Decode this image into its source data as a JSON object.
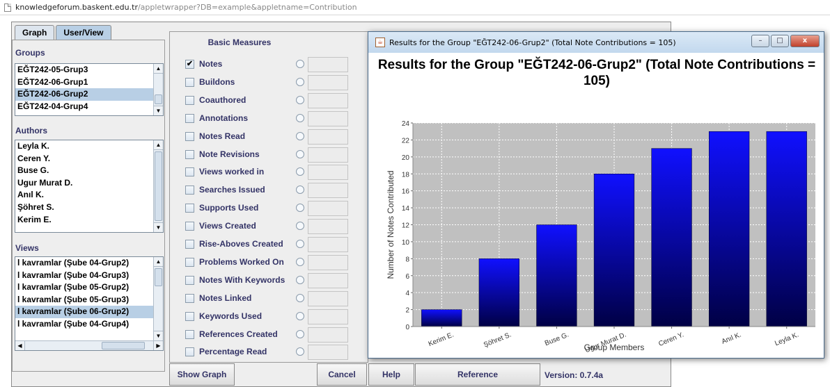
{
  "browser": {
    "url_domain": "knowledgeforum.baskent.edu.tr",
    "url_path": "/appletwrapper?DB=example&appletname=Contribution"
  },
  "tabs": [
    "Graph",
    "User/View"
  ],
  "groups": {
    "label": "Groups",
    "items": [
      "EĞT242-05-Grup3",
      "EĞT242-06-Grup1",
      "EĞT242-06-Grup2",
      "EĞT242-04-Grup4"
    ],
    "selected": "EĞT242-06-Grup2"
  },
  "authors": {
    "label": "Authors",
    "items": [
      "Leyla K.",
      "Ceren Y.",
      "Buse G.",
      "Ugur Murat D.",
      "Anıl K.",
      "Şöhret S.",
      "Kerim E."
    ]
  },
  "views": {
    "label": "Views",
    "items": [
      "l kavramlar (Şube 04-Grup2)",
      "l kavramlar (Şube 04-Grup3)",
      "l kavramlar (Şube 05-Grup2)",
      "l kavramlar (Şube 05-Grup3)",
      "l kavramlar (Şube 06-Grup2)",
      "l kavramlar (Şube 04-Grup4)"
    ],
    "selected": "l kavramlar (Şube 06-Grup2)"
  },
  "measures": {
    "title": "Basic Measures",
    "items": [
      {
        "label": "Notes",
        "checked": true
      },
      {
        "label": "Buildons",
        "checked": false
      },
      {
        "label": "Coauthored",
        "checked": false
      },
      {
        "label": "Annotations",
        "checked": false
      },
      {
        "label": "Notes Read",
        "checked": false
      },
      {
        "label": "Note Revisions",
        "checked": false
      },
      {
        "label": "Views worked in",
        "checked": false
      },
      {
        "label": "Searches Issued",
        "checked": false
      },
      {
        "label": "Supports Used",
        "checked": false
      },
      {
        "label": "Views Created",
        "checked": false
      },
      {
        "label": "Rise-Aboves Created",
        "checked": false
      },
      {
        "label": "Problems Worked On",
        "checked": false
      },
      {
        "label": "Notes With Keywords",
        "checked": false
      },
      {
        "label": "Notes Linked",
        "checked": false
      },
      {
        "label": "Keywords Used",
        "checked": false
      },
      {
        "label": "References Created",
        "checked": false
      },
      {
        "label": "Percentage Read",
        "checked": false
      }
    ]
  },
  "buttons": {
    "show_graph": "Show Graph",
    "cancel": "Cancel",
    "help": "Help",
    "reference": "Reference"
  },
  "version": "Version: 0.7.4a",
  "popup": {
    "window_title": "Results for the Group \"EĞT242-06-Grup2\" (Total Note Contributions = 105)",
    "controls": {
      "minimize": "–",
      "maximize": "□",
      "close": "x"
    }
  },
  "colors": {
    "bar_top": "#1010ff",
    "bar_bottom": "#000044",
    "plot_bg": "#c0c0c0"
  },
  "chart_data": {
    "type": "bar",
    "title": "Results for the Group \"EĞT242-06-Grup2\" (Total Note Contributions = 105)",
    "xlabel": "Group Members",
    "ylabel": "Number of Notes Contributed",
    "categories": [
      "Kerim E.",
      "Şöhret S.",
      "Buse G.",
      "Ugur Murat D.",
      "Ceren Y.",
      "Anıl K.",
      "Leyla K."
    ],
    "values": [
      2,
      8,
      12,
      18,
      21,
      23,
      23
    ],
    "ylim": [
      0,
      24
    ],
    "yticks": [
      0,
      2,
      4,
      6,
      8,
      10,
      12,
      14,
      16,
      18,
      20,
      22,
      24
    ],
    "grid": true,
    "legend": "none"
  }
}
